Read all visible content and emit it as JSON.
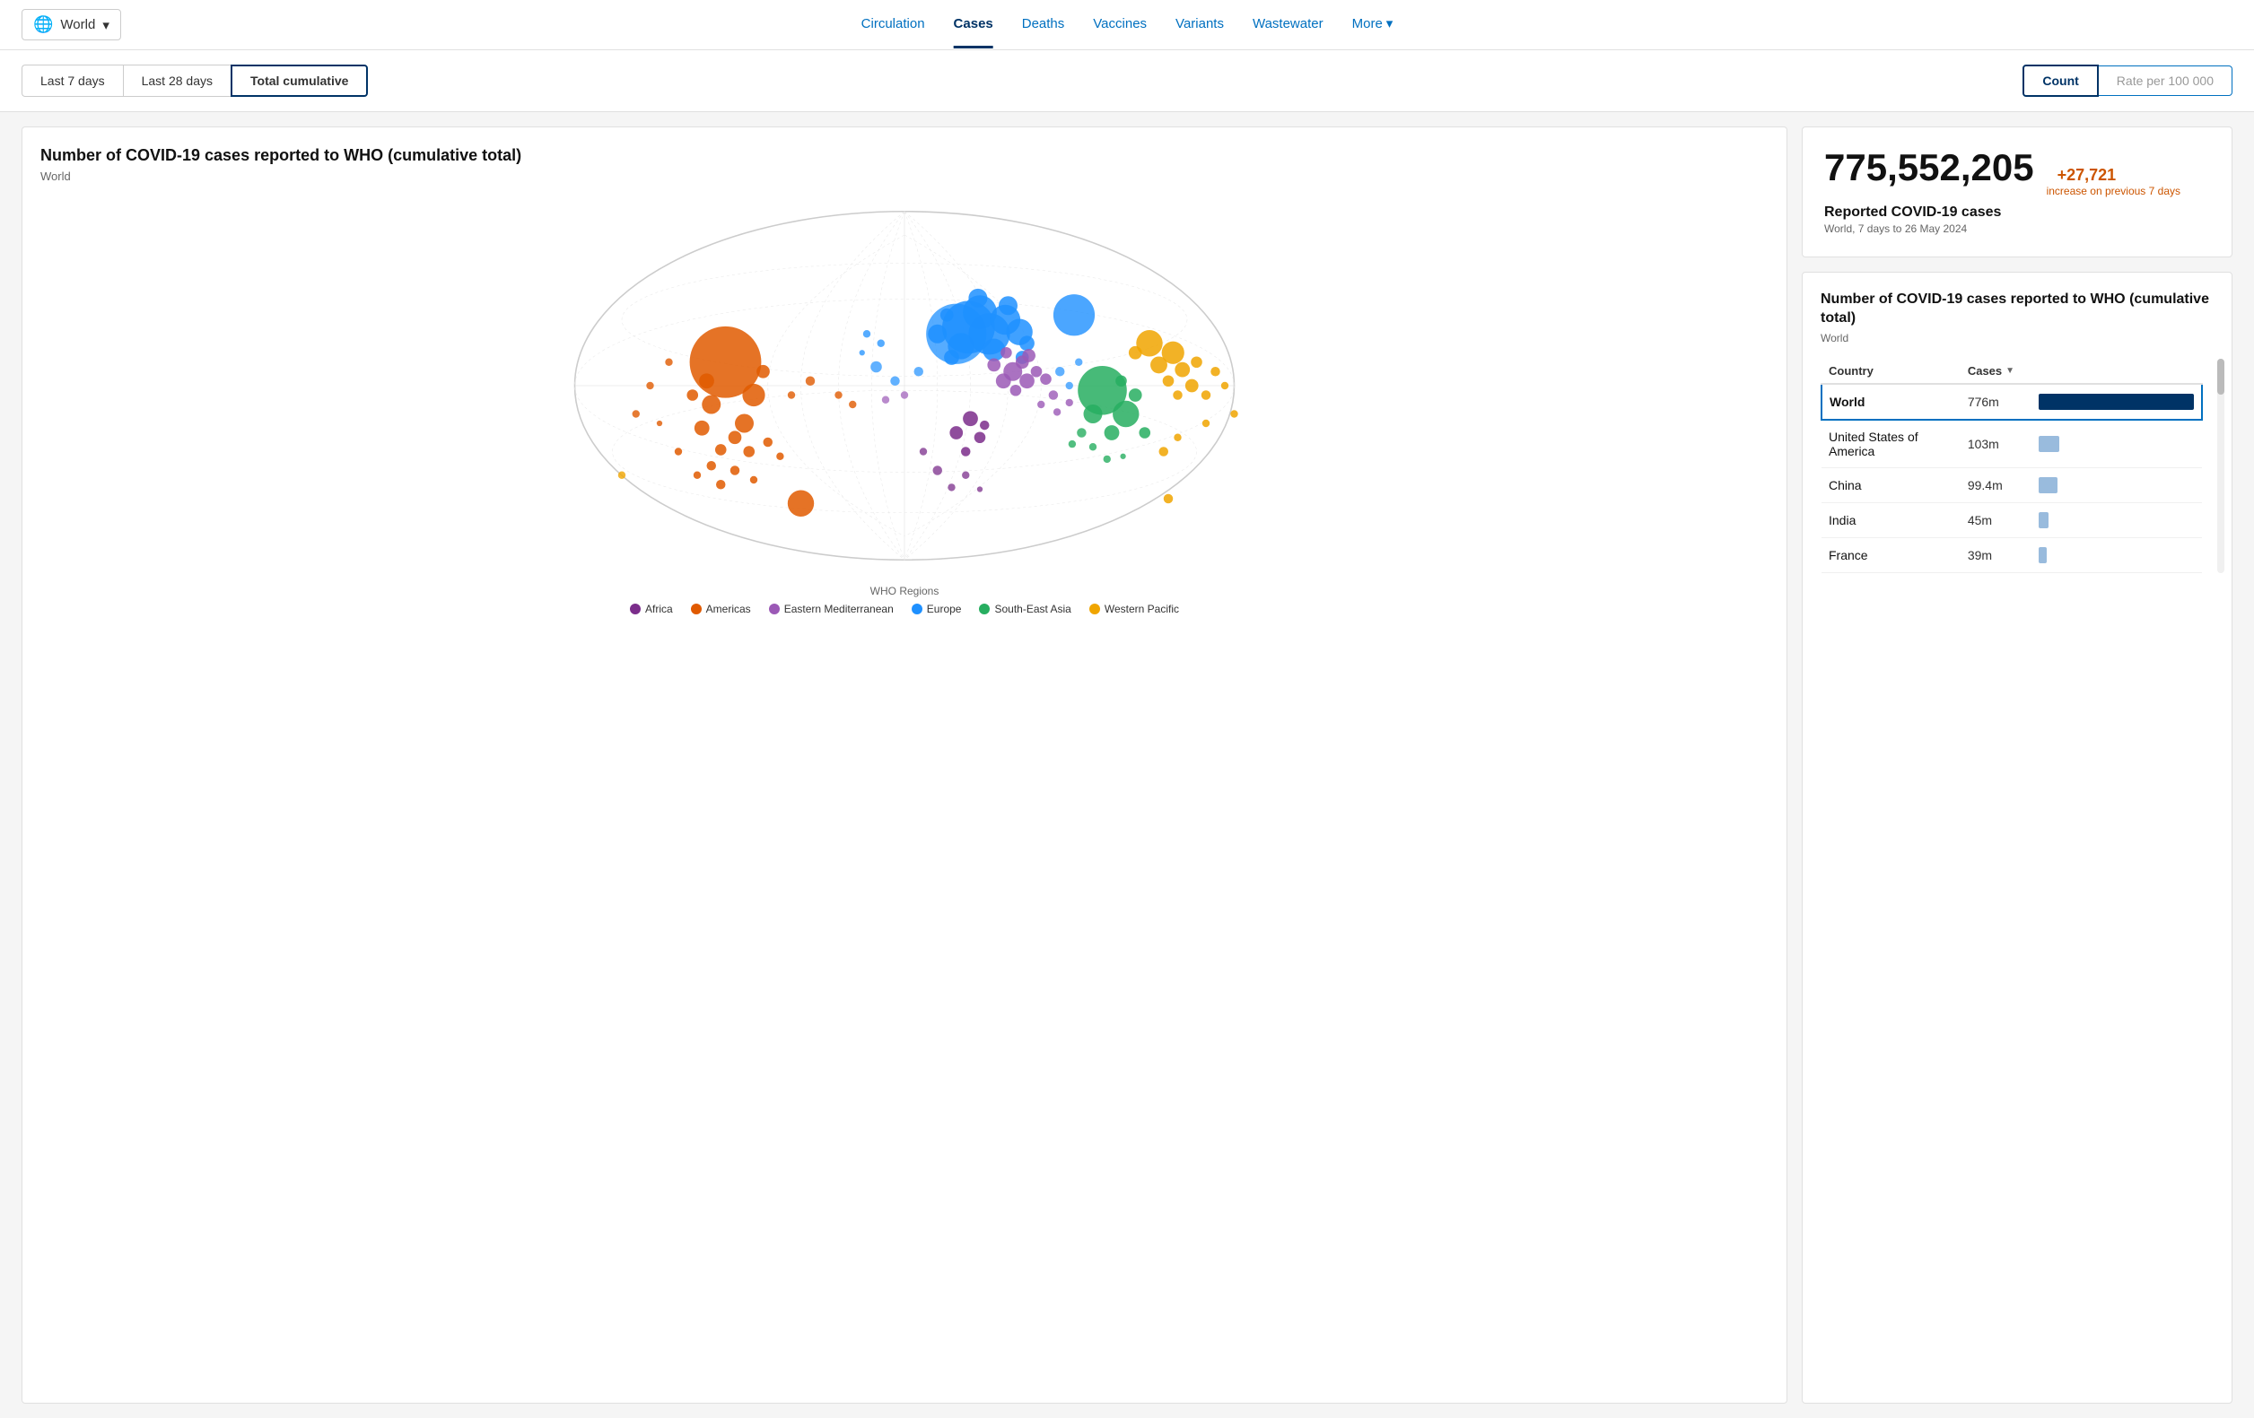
{
  "header": {
    "world_label": "World",
    "nav_tabs": [
      {
        "id": "circulation",
        "label": "Circulation",
        "active": false
      },
      {
        "id": "cases",
        "label": "Cases",
        "active": true
      },
      {
        "id": "deaths",
        "label": "Deaths",
        "active": false
      },
      {
        "id": "vaccines",
        "label": "Vaccines",
        "active": false
      },
      {
        "id": "variants",
        "label": "Variants",
        "active": false
      },
      {
        "id": "wastewater",
        "label": "Wastewater",
        "active": false
      },
      {
        "id": "more",
        "label": "More",
        "active": false
      }
    ]
  },
  "filter_bar": {
    "time_tabs": [
      {
        "id": "7days",
        "label": "Last 7 days",
        "active": false
      },
      {
        "id": "28days",
        "label": "Last 28 days",
        "active": false
      },
      {
        "id": "cumulative",
        "label": "Total cumulative",
        "active": true
      }
    ],
    "count_btn": "Count",
    "rate_btn": "Rate per 100 000"
  },
  "map_panel": {
    "title": "Number of COVID-19 cases reported to WHO (cumulative total)",
    "subtitle": "World",
    "legend": {
      "title": "WHO Regions",
      "items": [
        {
          "id": "africa",
          "label": "Africa",
          "color": "#7B2D8B"
        },
        {
          "id": "americas",
          "label": "Americas",
          "color": "#E05A00"
        },
        {
          "id": "eastern_med",
          "label": "Eastern Mediterranean",
          "color": "#9B59B6"
        },
        {
          "id": "europe",
          "label": "Europe",
          "color": "#1E90FF"
        },
        {
          "id": "south_east_asia",
          "label": "South-East Asia",
          "color": "#27AE60"
        },
        {
          "id": "western_pacific",
          "label": "Western Pacific",
          "color": "#F0A500"
        }
      ]
    }
  },
  "stats_card": {
    "number": "775,552,205",
    "increase": "+27,721",
    "increase_label": "increase on previous 7 days",
    "label": "Reported COVID-19 cases",
    "meta": "World, 7 days to 26 May 2024"
  },
  "table_card": {
    "title": "Number of COVID-19 cases reported to WHO (cumulative total)",
    "subtitle": "World",
    "columns": [
      "Country",
      "Cases"
    ],
    "rows": [
      {
        "country": "World",
        "cases": "776m",
        "bar_pct": 100,
        "highlighted": true,
        "bar_dark": true
      },
      {
        "country": "United States of America",
        "cases": "103m",
        "bar_pct": 13,
        "highlighted": false,
        "bar_dark": false
      },
      {
        "country": "China",
        "cases": "99.4m",
        "bar_pct": 12,
        "highlighted": false,
        "bar_dark": false
      },
      {
        "country": "India",
        "cases": "45m",
        "bar_pct": 6,
        "highlighted": false,
        "bar_dark": false
      },
      {
        "country": "France",
        "cases": "39m",
        "bar_pct": 5,
        "highlighted": false,
        "bar_dark": false
      }
    ]
  },
  "icons": {
    "globe": "🌐",
    "chevron_down": "▾",
    "sort_down": "▼",
    "chevron_right": "›"
  }
}
